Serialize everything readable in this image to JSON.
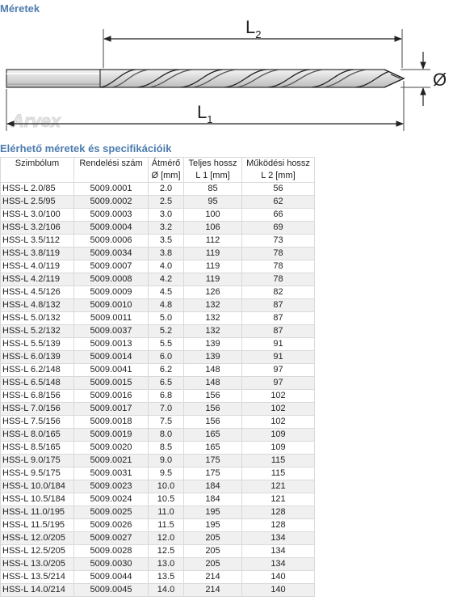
{
  "heading_dimensions": "Méretek",
  "diagram": {
    "label_l2": "L",
    "label_l2_sub": "2",
    "label_l1": "L",
    "label_l1_sub": "1",
    "label_diameter": "Ø",
    "brand_logo": "Arvex"
  },
  "heading_specs": "Elérhető méretek és specifikációik",
  "table": {
    "headers": [
      {
        "line1": "Szimbólum",
        "line2": ""
      },
      {
        "line1": "Rendelési szám",
        "line2": ""
      },
      {
        "line1": "Átmérő",
        "line2": "Ø [mm]"
      },
      {
        "line1": "Teljes hossz",
        "line2": "L 1 [mm]"
      },
      {
        "line1": "Működési hossz",
        "line2": "L 2 [mm]"
      }
    ],
    "rows": [
      [
        "HSS-L 2.0/85",
        "5009.0001",
        "2.0",
        "85",
        "56"
      ],
      [
        "HSS-L 2.5/95",
        "5009.0002",
        "2.5",
        "95",
        "62"
      ],
      [
        "HSS-L 3.0/100",
        "5009.0003",
        "3.0",
        "100",
        "66"
      ],
      [
        "HSS-L 3.2/106",
        "5009.0004",
        "3.2",
        "106",
        "69"
      ],
      [
        "HSS-L 3.5/112",
        "5009.0006",
        "3.5",
        "112",
        "73"
      ],
      [
        "HSS-L 3.8/119",
        "5009.0034",
        "3.8",
        "119",
        "78"
      ],
      [
        "HSS-L 4.0/119",
        "5009.0007",
        "4.0",
        "119",
        "78"
      ],
      [
        "HSS-L 4.2/119",
        "5009.0008",
        "4.2",
        "119",
        "78"
      ],
      [
        "HSS-L 4.5/126",
        "5009.0009",
        "4.5",
        "126",
        "82"
      ],
      [
        "HSS-L 4.8/132",
        "5009.0010",
        "4.8",
        "132",
        "87"
      ],
      [
        "HSS-L 5.0/132",
        "5009.0011",
        "5.0",
        "132",
        "87"
      ],
      [
        "HSS-L 5.2/132",
        "5009.0037",
        "5.2",
        "132",
        "87"
      ],
      [
        "HSS-L 5.5/139",
        "5009.0013",
        "5.5",
        "139",
        "91"
      ],
      [
        "HSS-L 6.0/139",
        "5009.0014",
        "6.0",
        "139",
        "91"
      ],
      [
        "HSS-L 6.2/148",
        "5009.0041",
        "6.2",
        "148",
        "97"
      ],
      [
        "HSS-L 6.5/148",
        "5009.0015",
        "6.5",
        "148",
        "97"
      ],
      [
        "HSS-L 6.8/156",
        "5009.0016",
        "6.8",
        "156",
        "102"
      ],
      [
        "HSS-L 7.0/156",
        "5009.0017",
        "7.0",
        "156",
        "102"
      ],
      [
        "HSS-L 7.5/156",
        "5009.0018",
        "7.5",
        "156",
        "102"
      ],
      [
        "HSS-L 8.0/165",
        "5009.0019",
        "8.0",
        "165",
        "109"
      ],
      [
        "HSS-L 8.5/165",
        "5009.0020",
        "8.5",
        "165",
        "109"
      ],
      [
        "HSS-L 9.0/175",
        "5009.0021",
        "9.0",
        "175",
        "115"
      ],
      [
        "HSS-L 9.5/175",
        "5009.0031",
        "9.5",
        "175",
        "115"
      ],
      [
        "HSS-L 10.0/184",
        "5009.0023",
        "10.0",
        "184",
        "121"
      ],
      [
        "HSS-L 10.5/184",
        "5009.0024",
        "10.5",
        "184",
        "121"
      ],
      [
        "HSS-L 11.0/195",
        "5009.0025",
        "11.0",
        "195",
        "128"
      ],
      [
        "HSS-L 11.5/195",
        "5009.0026",
        "11.5",
        "195",
        "128"
      ],
      [
        "HSS-L 12.0/205",
        "5009.0027",
        "12.0",
        "205",
        "134"
      ],
      [
        "HSS-L 12.5/205",
        "5009.0028",
        "12.5",
        "205",
        "134"
      ],
      [
        "HSS-L 13.0/205",
        "5009.0030",
        "13.0",
        "205",
        "134"
      ],
      [
        "HSS-L 13.5/214",
        "5009.0044",
        "13.5",
        "214",
        "140"
      ],
      [
        "HSS-L 14.0/214",
        "5009.0045",
        "14.0",
        "214",
        "140"
      ]
    ]
  }
}
